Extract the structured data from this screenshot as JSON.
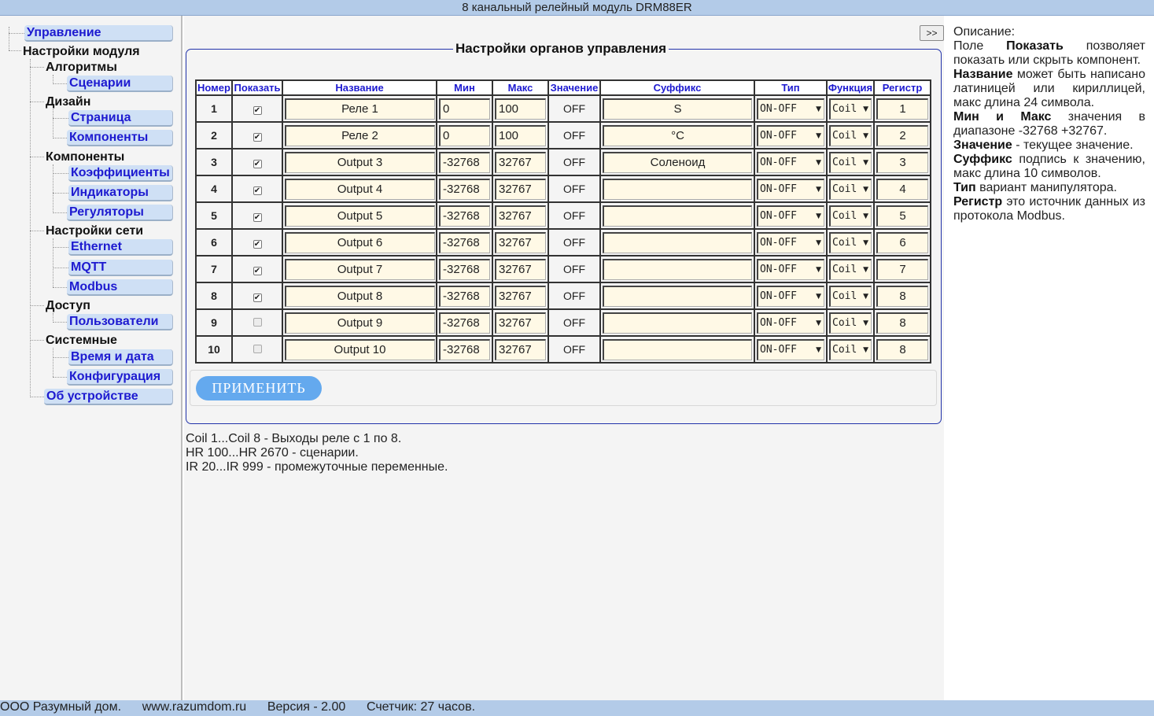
{
  "window_title": "8 канальный релейный модуль DRM88ER",
  "sidebar": {
    "control": "Управление",
    "module_settings": "Настройки модуля",
    "algorithms": "Алгоритмы",
    "scenarios": "Сценарии",
    "design": "Дизайн",
    "page": "Страница",
    "components": "Компоненты",
    "components_group": "Компоненты",
    "coefficients": "Коэффициенты",
    "indicators": "Индикаторы",
    "regulators": "Регуляторы",
    "network_settings": "Настройки сети",
    "ethernet": "Ethernet",
    "mqtt": "MQTT",
    "modbus": "Modbus",
    "access": "Доступ",
    "users": "Пользователи",
    "system": "Системные",
    "datetime": "Время и дата",
    "configuration": "Конфигурация",
    "about": "Об устройстве"
  },
  "expand_label": ">>",
  "panel_title": "Настройки органов управления",
  "table": {
    "headers": [
      "Номер",
      "Показать",
      "Название",
      "Мин",
      "Макс",
      "Значение",
      "Суффикс",
      "Тип",
      "Функция",
      "Регистр"
    ],
    "rows": [
      {
        "num": "1",
        "show": true,
        "name": "Реле 1",
        "min": "0",
        "max": "100",
        "value": "OFF",
        "suffix": "S",
        "type": "ON-OFF",
        "func": "Coil",
        "reg": "1"
      },
      {
        "num": "2",
        "show": true,
        "name": "Реле 2",
        "min": "0",
        "max": "100",
        "value": "OFF",
        "suffix": "°C",
        "type": "ON-OFF",
        "func": "Coil",
        "reg": "2"
      },
      {
        "num": "3",
        "show": true,
        "name": "Output 3",
        "min": "-32768",
        "max": "32767",
        "value": "OFF",
        "suffix": "Соленоид",
        "type": "ON-OFF",
        "func": "Coil",
        "reg": "3"
      },
      {
        "num": "4",
        "show": true,
        "name": "Output 4",
        "min": "-32768",
        "max": "32767",
        "value": "OFF",
        "suffix": "",
        "type": "ON-OFF",
        "func": "Coil",
        "reg": "4"
      },
      {
        "num": "5",
        "show": true,
        "name": "Output 5",
        "min": "-32768",
        "max": "32767",
        "value": "OFF",
        "suffix": "",
        "type": "ON-OFF",
        "func": "Coil",
        "reg": "5"
      },
      {
        "num": "6",
        "show": true,
        "name": "Output 6",
        "min": "-32768",
        "max": "32767",
        "value": "OFF",
        "suffix": "",
        "type": "ON-OFF",
        "func": "Coil",
        "reg": "6"
      },
      {
        "num": "7",
        "show": true,
        "name": "Output 7",
        "min": "-32768",
        "max": "32767",
        "value": "OFF",
        "suffix": "",
        "type": "ON-OFF",
        "func": "Coil",
        "reg": "7"
      },
      {
        "num": "8",
        "show": true,
        "name": "Output 8",
        "min": "-32768",
        "max": "32767",
        "value": "OFF",
        "suffix": "",
        "type": "ON-OFF",
        "func": "Coil",
        "reg": "8"
      },
      {
        "num": "9",
        "show": false,
        "name": "Output 9",
        "min": "-32768",
        "max": "32767",
        "value": "OFF",
        "suffix": "",
        "type": "ON-OFF",
        "func": "Coil",
        "reg": "8"
      },
      {
        "num": "10",
        "show": false,
        "name": "Output 10",
        "min": "-32768",
        "max": "32767",
        "value": "OFF",
        "suffix": "",
        "type": "ON-OFF",
        "func": "Coil",
        "reg": "8"
      }
    ]
  },
  "apply_label": "ПРИМЕНИТЬ",
  "notes": [
    "Coil 1...Coil 8 - Выходы реле с 1 по 8.",
    "HR 100...HR 2670 - сценарии.",
    "IR 20...IR 999 - промежуточные переменные."
  ],
  "description": {
    "title": "Описание:",
    "p1_pre": "Поле",
    "p1_bold": "Показать",
    "p1_post": "позволяет показать или скрыть компонент.",
    "p2_bold": "Название",
    "p2_post": "может быть написано латиницей или кириллицей, макс длина 24 символа.",
    "p3_bold1": "Мин",
    "p3_mid": "и",
    "p3_bold2": "Макс",
    "p3_post": "значения в диапазоне -32768 +32767.",
    "p4_bold": "Значение",
    "p4_post": "- текущее значение.",
    "p5_bold": "Суффикс",
    "p5_post": "подпись к значению, макс длина 10 символов.",
    "p6_bold": "Тип",
    "p6_post": "вариант манипулятора.",
    "p7_bold": "Регистр",
    "p7_post": "это источник данных из протокола Modbus."
  },
  "footer": {
    "company": "ООО Разумный дом.",
    "site": "www.razumdom.ru",
    "version": "Версия - 2.00",
    "counter": "Счетчик: 27 часов."
  }
}
